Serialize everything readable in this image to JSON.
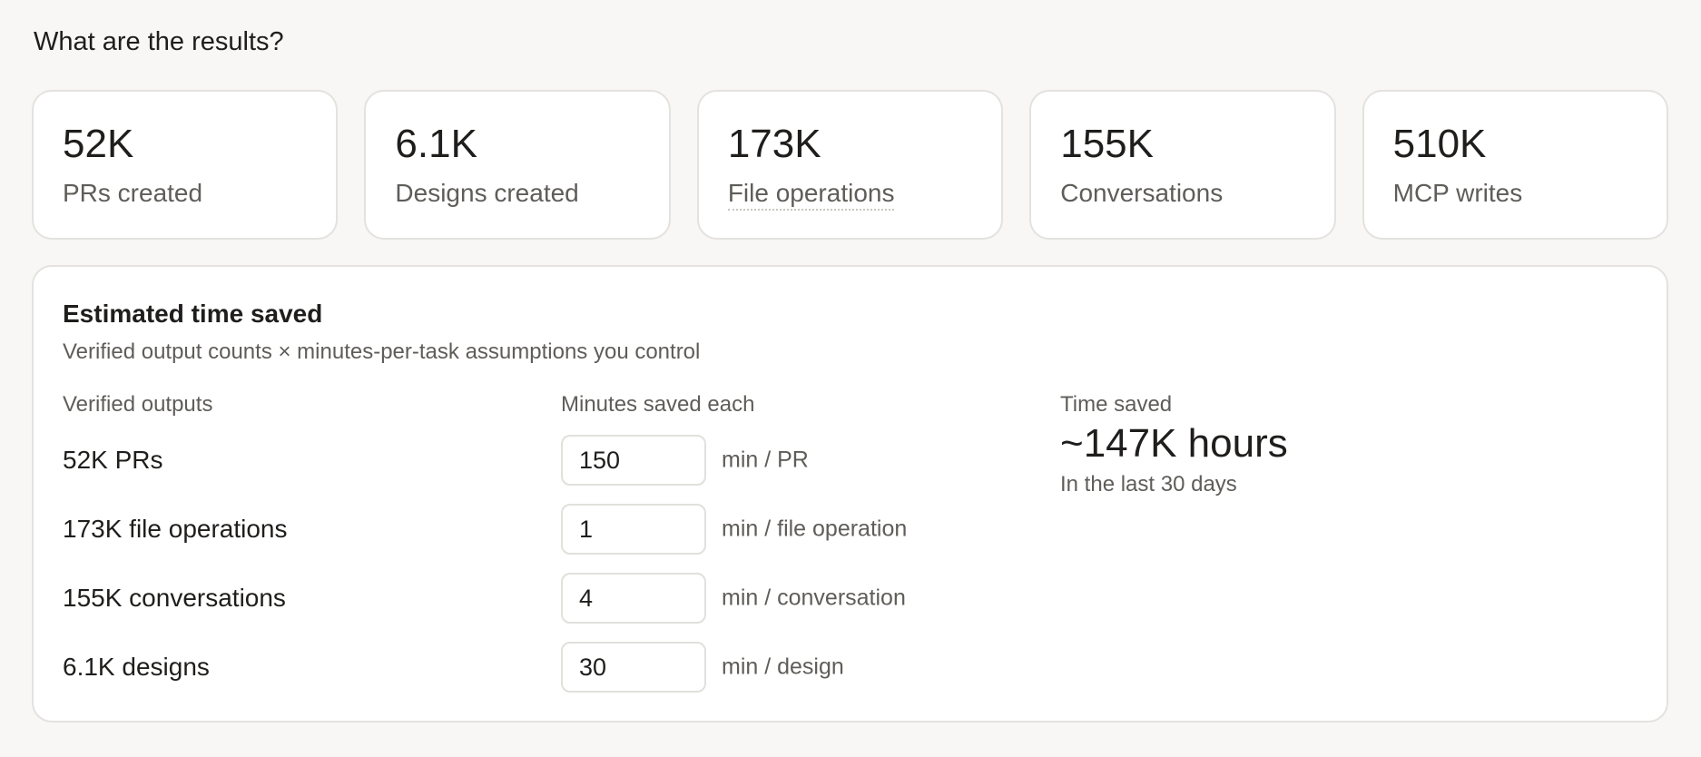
{
  "section_title": "What are the results?",
  "stats": [
    {
      "value": "52K",
      "label": "PRs created"
    },
    {
      "value": "6.1K",
      "label": "Designs created"
    },
    {
      "value": "173K",
      "label": "File operations"
    },
    {
      "value": "155K",
      "label": "Conversations"
    },
    {
      "value": "510K",
      "label": "MCP writes"
    }
  ],
  "time_saved": {
    "title": "Estimated time saved",
    "subtitle": "Verified output counts × minutes-per-task assumptions you control",
    "col_outputs": "Verified outputs",
    "col_minutes": "Minutes saved each",
    "col_saved": "Time saved",
    "rows": [
      {
        "label": "52K PRs",
        "minutes": "150",
        "unit": "min / PR"
      },
      {
        "label": "173K file operations",
        "minutes": "1",
        "unit": "min / file operation"
      },
      {
        "label": "155K conversations",
        "minutes": "4",
        "unit": "min / conversation"
      },
      {
        "label": "6.1K designs",
        "minutes": "30",
        "unit": "min / design"
      }
    ],
    "result_value": "~147K hours",
    "result_period": "In the last 30 days"
  }
}
